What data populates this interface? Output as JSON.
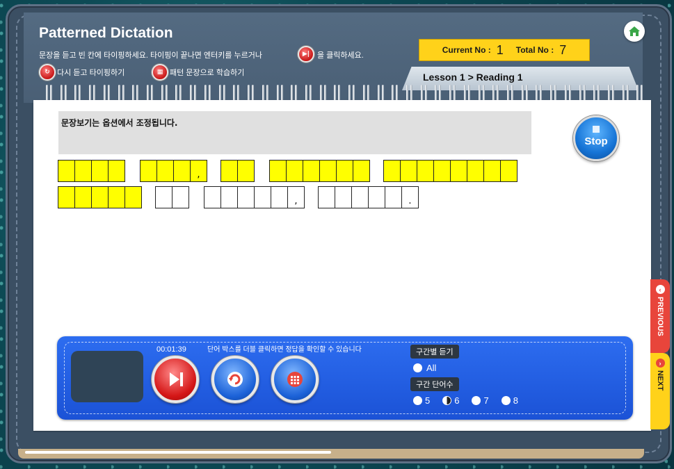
{
  "app": {
    "title": "Patterned Dictation",
    "instruction_line1_a": "문장을 듣고 빈 칸에 타이핑하세요. 타이핑이 끝나면 엔터키를 누르거나",
    "instruction_line1_b": "을 클릭하세요.",
    "instruction_replay": "다시 듣고 타이핑하기",
    "instruction_pattern": "패턴 문장으로 학습하기"
  },
  "counter": {
    "current_label": "Current No :",
    "current_value": "1",
    "total_label": "Total No :",
    "total_value": "7"
  },
  "lesson": {
    "breadcrumb": "Lesson 1 > Reading 1"
  },
  "sentence": {
    "notice": "문장보기는 옵션에서 조정됩니다.",
    "words": [
      {
        "cells": 4,
        "filled": true,
        "punct": ""
      },
      {
        "cells": 4,
        "filled": true,
        "punct": ","
      },
      {
        "cells": 2,
        "filled": true,
        "punct": ""
      },
      {
        "cells": 6,
        "filled": true,
        "punct": ""
      },
      {
        "cells": 8,
        "filled": true,
        "punct": ""
      },
      {
        "cells": 5,
        "filled": true,
        "punct": ""
      },
      {
        "cells": 2,
        "filled": false,
        "punct": ""
      },
      {
        "cells": 6,
        "filled": false,
        "punct": ","
      },
      {
        "cells": 6,
        "filled": false,
        "punct": "."
      }
    ]
  },
  "stop_button": {
    "label": "Stop"
  },
  "control": {
    "timer": "00:01:39",
    "hint": "단어 박스를 더블 클릭하면 정답을 확인할 수 있습니다",
    "section_listen": "구간별 듣기",
    "option_all": "All",
    "section_words": "구간 단어수",
    "word_counts": [
      "5",
      "6",
      "7",
      "8"
    ],
    "selected_word_count": "6"
  },
  "nav": {
    "previous": "PREVIOUS",
    "next": "NEXT"
  },
  "colors": {
    "accent_yellow": "#ffff00",
    "panel_blue": "#2d6df0",
    "tab_red": "#e8453b",
    "tab_yellow": "#ffd21a"
  },
  "icons": {
    "home": "home-icon",
    "enter": "play-next-icon",
    "replay": "replay-icon",
    "pattern": "grid-icon"
  }
}
